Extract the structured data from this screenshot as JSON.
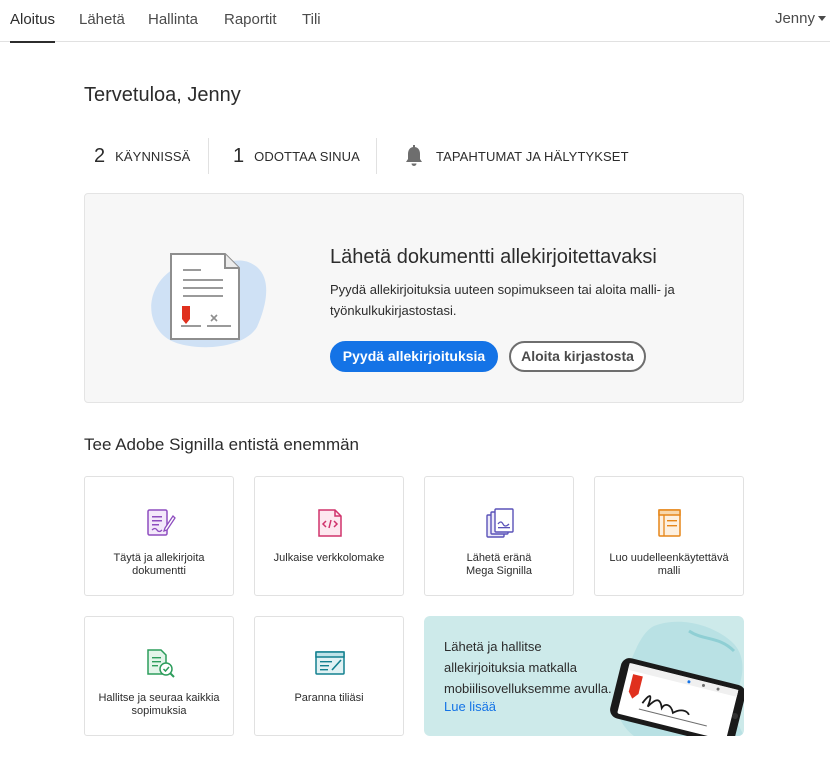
{
  "nav": {
    "tabs": [
      {
        "label": "Aloitus",
        "active": true
      },
      {
        "label": "Lähetä"
      },
      {
        "label": "Hallinta"
      },
      {
        "label": "Raportit"
      },
      {
        "label": "Tili"
      }
    ],
    "user": "Jenny"
  },
  "welcome": "Tervetuloa, Jenny",
  "stats": [
    {
      "count": "2",
      "label": "KÄYNNISSÄ"
    },
    {
      "count": "1",
      "label": "ODOTTAA SINUA"
    },
    {
      "icon": "bell-icon",
      "label": "TAPAHTUMAT JA HÄLYTYKSET"
    }
  ],
  "hero": {
    "title": "Lähetä dokumentti allekirjoitettavaksi",
    "description": "Pyydä allekirjoituksia uuteen sopimukseen tai aloita malli- ja työnkulkukirjastostasi.",
    "primary_button": "Pyydä allekirjoituksia",
    "secondary_button": "Aloita kirjastosta"
  },
  "section_title": "Tee Adobe Signilla entistä enemmän",
  "tiles": [
    {
      "icon": "fill-sign-icon",
      "line1": "Täytä ja allekirjoita",
      "line2": "dokumentti"
    },
    {
      "icon": "web-form-icon",
      "line1": "Julkaise verkkolomake",
      "line2": ""
    },
    {
      "icon": "mega-sign-icon",
      "line1": "Lähetä eränä",
      "line2": "Mega Signilla"
    },
    {
      "icon": "template-icon",
      "line1": "Luo uudelleenkäytettävä",
      "line2": "malli"
    },
    {
      "icon": "track-agreements-icon",
      "line1": "Hallitse ja seuraa kaikkia",
      "line2": "sopimuksia"
    },
    {
      "icon": "account-icon",
      "line1": "Paranna tiliäsi",
      "line2": ""
    }
  ],
  "promo": {
    "text": "Lähetä ja hallitse allekirjoituksia matkalla mobiilisovelluksemme avulla.",
    "link": "Lue lisää"
  },
  "colors": {
    "accent": "#1473e6",
    "promo_bg": "#cdeaea",
    "signature_red": "#e0301e"
  }
}
